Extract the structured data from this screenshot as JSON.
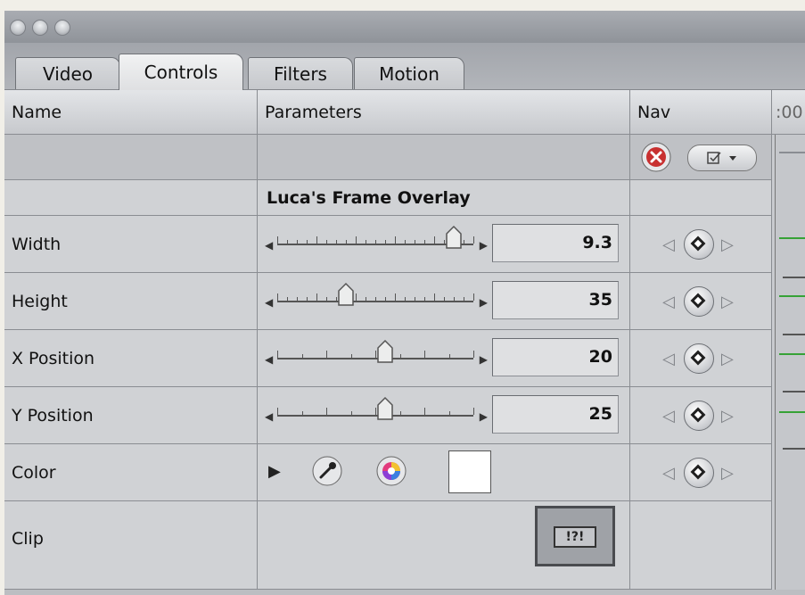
{
  "tabs": [
    {
      "label": "Video",
      "active": false
    },
    {
      "label": "Controls",
      "active": true
    },
    {
      "label": "Filters",
      "active": false
    },
    {
      "label": "Motion",
      "active": false
    }
  ],
  "columns": {
    "name": "Name",
    "parameters": "Parameters",
    "nav": "Nav",
    "timecode": ":00"
  },
  "filter_title": "Luca's Frame Overlay",
  "parameters": [
    {
      "name": "Width",
      "value": "9.3",
      "slider_fraction": 0.9
    },
    {
      "name": "Height",
      "value": "35",
      "slider_fraction": 0.35
    },
    {
      "name": "X Position",
      "value": "20",
      "slider_fraction": 0.55
    },
    {
      "name": "Y Position",
      "value": "25",
      "slider_fraction": 0.55
    }
  ],
  "color_row": {
    "name": "Color",
    "swatch_color": "#ffffff"
  },
  "clip_row": {
    "name": "Clip",
    "well_label": "!?!"
  },
  "icons": {
    "reset": "red-x-reset-icon",
    "enable": "checkbox-dropdown-icon",
    "eyedropper": "eyedropper-icon",
    "color_wheel": "color-wheel-icon",
    "disclosure": "disclosure-triangle-icon",
    "keyframe": "keyframe-diamond-icon"
  }
}
